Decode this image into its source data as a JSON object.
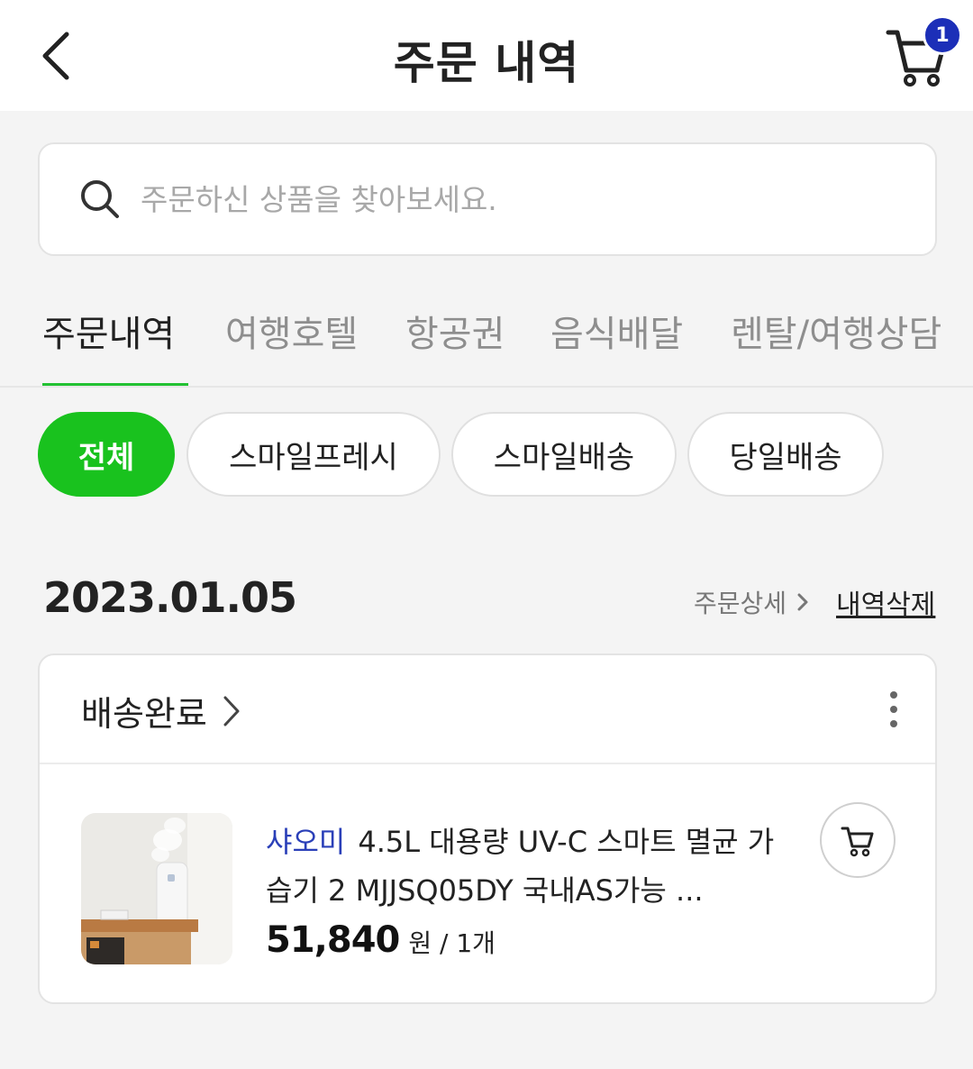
{
  "header": {
    "title": "주문 내역",
    "cart_count": "1",
    "back_icon": "chevron-left-icon",
    "cart_icon": "cart-icon"
  },
  "search": {
    "placeholder": "주문하신 상품을 찾아보세요.",
    "icon": "search-icon"
  },
  "tabs": [
    {
      "label": "주문내역",
      "active": true
    },
    {
      "label": "여행호텔",
      "active": false
    },
    {
      "label": "항공권",
      "active": false
    },
    {
      "label": "음식배달",
      "active": false
    },
    {
      "label": "렌탈/여행상담",
      "active": false
    }
  ],
  "filters": [
    {
      "label": "전체",
      "active": true
    },
    {
      "label": "스마일프레시",
      "active": false
    },
    {
      "label": "스마일배송",
      "active": false
    },
    {
      "label": "당일배송",
      "active": false
    }
  ],
  "order": {
    "date": "2023.01.05",
    "detail_link": "주문상세",
    "delete_link": "내역삭제",
    "status": "배송완료",
    "item": {
      "brand": "샤오미",
      "name": "4.5L 대용량 UV-C 스마트 멸균 가습기 2 MJJSQ05DY 국내AS가능 ...",
      "price": "51,840",
      "unit": "원 / 1개"
    }
  },
  "colors": {
    "accent_green": "#19c21e",
    "badge_blue": "#1c2fb8",
    "brand_blue": "#2a3fb8"
  }
}
